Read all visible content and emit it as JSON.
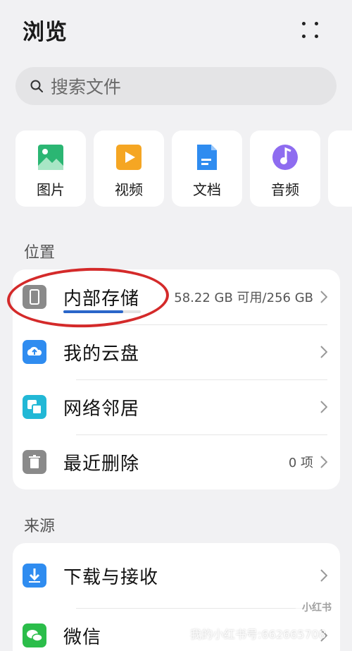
{
  "header": {
    "title": "浏览"
  },
  "search": {
    "placeholder": "搜索文件"
  },
  "categories": [
    {
      "label": "图片",
      "icon": "image-icon",
      "color": "#2bb673"
    },
    {
      "label": "视频",
      "icon": "video-icon",
      "color": "#f5a623"
    },
    {
      "label": "文档",
      "icon": "document-icon",
      "color": "#2f8cf0"
    },
    {
      "label": "音频",
      "icon": "audio-icon",
      "color": "#8e6cf0"
    }
  ],
  "location": {
    "label": "位置",
    "items": [
      {
        "title": "内部存储",
        "detail": "58.22 GB 可用/256 GB",
        "icon": "phone-icon",
        "storage_used_fraction": 0.77
      },
      {
        "title": "我的云盘",
        "detail": "",
        "icon": "cloud-drive-icon"
      },
      {
        "title": "网络邻居",
        "detail": "",
        "icon": "network-neighbor-icon"
      },
      {
        "title": "最近删除",
        "detail": "0 项",
        "icon": "trash-icon"
      }
    ]
  },
  "source": {
    "label": "来源",
    "items": [
      {
        "title": "下载与接收",
        "icon": "download-icon"
      },
      {
        "title": "微信",
        "icon": "wechat-icon"
      }
    ]
  },
  "watermark": {
    "text": "我的小红书号:662665708",
    "logo": "小红书"
  }
}
